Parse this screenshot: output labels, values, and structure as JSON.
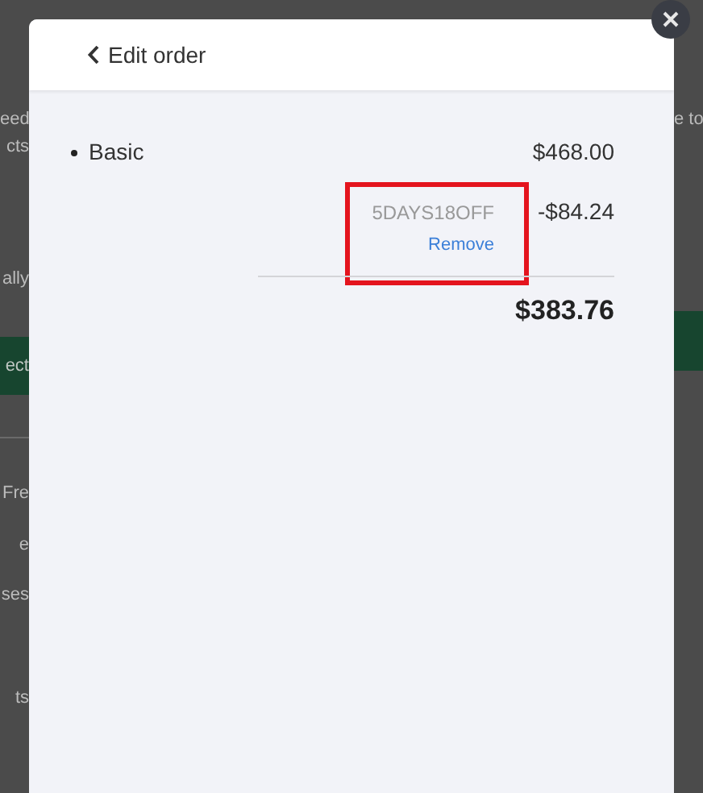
{
  "background_page": {
    "left_texts": [
      {
        "kind": "text",
        "text": "eed"
      },
      {
        "kind": "text",
        "text": "cts"
      },
      {
        "kind": "text",
        "text": "ally"
      },
      {
        "kind": "button",
        "text": "ect"
      },
      {
        "kind": "text",
        "text": "Fre"
      },
      {
        "kind": "text",
        "text": "e"
      },
      {
        "kind": "text",
        "text": "ses"
      },
      {
        "kind": "text",
        "text": "ts"
      }
    ],
    "right_texts": [
      {
        "kind": "text",
        "text": "e to"
      },
      {
        "kind": "button"
      }
    ]
  },
  "modal": {
    "back_label": "Edit order",
    "items": [
      {
        "name": "Basic",
        "price": "$468.00"
      }
    ],
    "discount": {
      "code": "5DAYS18OFF",
      "action": "Remove",
      "amount": "-$84.24",
      "highlighted": true
    },
    "total": "$383.76"
  }
}
